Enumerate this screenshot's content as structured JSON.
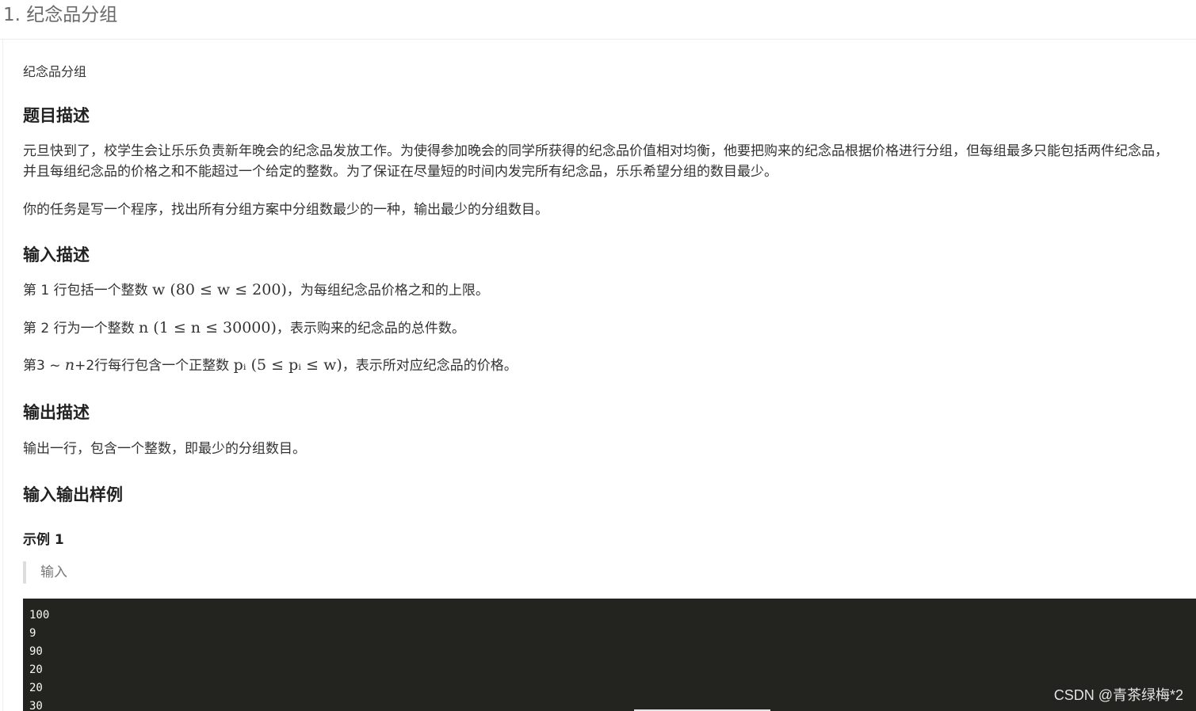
{
  "header": {
    "title": "1. 纪念品分组"
  },
  "problem": {
    "name": "纪念品分组",
    "description_heading": "题目描述",
    "description_p1": "元旦快到了，校学生会让乐乐负责新年晚会的纪念品发放工作。为使得参加晚会的同学所获得的纪念品价值相对均衡，他要把购来的纪念品根据价格进行分组，但每组最多只能包括两件纪念品，并且每组纪念品的价格之和不能超过一个给定的整数。为了保证在尽量短的时间内发完所有纪念品，乐乐希望分组的数目最少。",
    "description_p2": "你的任务是写一个程序，找出所有分组方案中分组数最少的一种，输出最少的分组数目。",
    "input_heading": "输入描述",
    "input_line1_prefix": "第 1 行包括一个整数 ",
    "input_line1_math": "w (80 ≤ w ≤ 200)",
    "input_line1_suffix": "，为每组纪念品价格之和的上限。",
    "input_line2_prefix": "第 2 行为一个整数 ",
    "input_line2_math": "n (1 ≤ n ≤ 30000)",
    "input_line2_suffix": "，表示购来的纪念品的总件数。",
    "input_line3_prefix": "第3 ~ ",
    "input_line3_var": "n",
    "input_line3_mid": "+2行每行包含一个正整数 ",
    "input_line3_math": "pᵢ (5 ≤ pᵢ ≤ w)",
    "input_line3_suffix": "，表示所对应纪念品的价格。",
    "output_heading": "输出描述",
    "output_text": "输出一行，包含一个整数，即最少的分组数目。",
    "samples_heading": "输入输出样例",
    "sample_title": "示例 1",
    "sample_input_label": "输入",
    "sample_input_lines": [
      "100",
      "9",
      "90",
      "20",
      "20",
      "30"
    ]
  },
  "watermark": "CSDN @青茶绿梅*2",
  "colors": {
    "code_bg": "#23241f",
    "code_fg": "#f8f8f2",
    "quote_border": "#dddddd"
  }
}
